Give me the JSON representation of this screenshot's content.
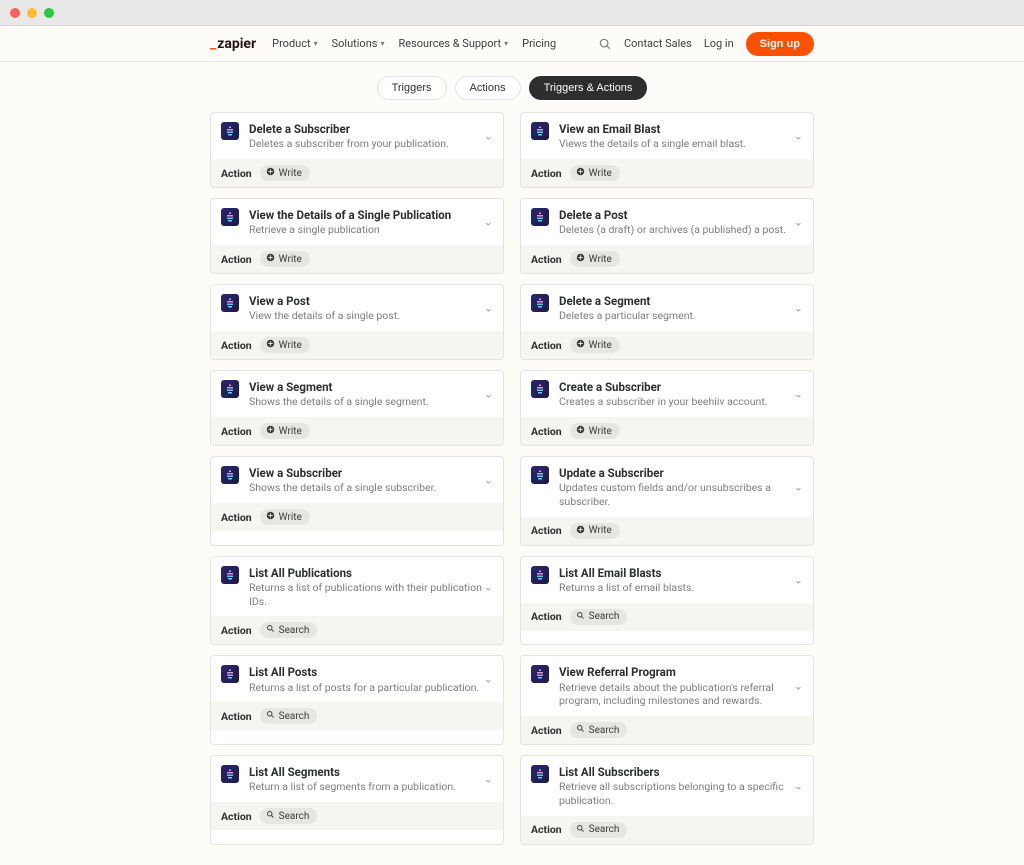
{
  "nav": {
    "brand": "zapier",
    "links": [
      {
        "label": "Product",
        "dropdown": true
      },
      {
        "label": "Solutions",
        "dropdown": true
      },
      {
        "label": "Resources & Support",
        "dropdown": true
      },
      {
        "label": "Pricing",
        "dropdown": false
      }
    ],
    "contact": "Contact Sales",
    "login": "Log in",
    "signup": "Sign up"
  },
  "filters": {
    "triggers": "Triggers",
    "actions": "Actions",
    "both": "Triggers & Actions"
  },
  "labels": {
    "kind_action": "Action",
    "chip_write": "Write",
    "chip_search": "Search"
  },
  "cards_left": [
    {
      "title": "Delete a Subscriber",
      "desc": "Deletes a subscriber from your publication.",
      "chip": "Write"
    },
    {
      "title": "View the Details of a Single Publication",
      "desc": "Retrieve a single publication",
      "chip": "Write"
    },
    {
      "title": "View a Post",
      "desc": "View the details of a single post.",
      "chip": "Write"
    },
    {
      "title": "View a Segment",
      "desc": "Shows the details of a single segment.",
      "chip": "Write"
    },
    {
      "title": "View a Subscriber",
      "desc": "Shows the details of a single subscriber.",
      "chip": "Write"
    },
    {
      "title": "List All Publications",
      "desc": "Returns a list of publications with their publication IDs.",
      "chip": "Search"
    },
    {
      "title": "List All Posts",
      "desc": "Returns a list of posts for a particular publication.",
      "chip": "Search"
    },
    {
      "title": "List All Segments",
      "desc": "Return a list of segments from a publication.",
      "chip": "Search"
    }
  ],
  "cards_right": [
    {
      "title": "View an Email Blast",
      "desc": "Views the details of a single email blast.",
      "chip": "Write"
    },
    {
      "title": "Delete a Post",
      "desc": "Deletes (a draft) or archives (a published) a post.",
      "chip": "Write"
    },
    {
      "title": "Delete a Segment",
      "desc": "Deletes a particular segment.",
      "chip": "Write"
    },
    {
      "title": "Create a Subscriber",
      "desc": "Creates a subscriber in your beehiiv account.",
      "chip": "Write"
    },
    {
      "title": "Update a Subscriber",
      "desc": "Updates custom fields and/or unsubscribes a subscriber.",
      "chip": "Write"
    },
    {
      "title": "List All Email Blasts",
      "desc": "Returns a list of email blasts.",
      "chip": "Search"
    },
    {
      "title": "View Referral Program",
      "desc": "Retrieve details about the publication's referral program, including milestones and rewards.",
      "chip": "Search"
    },
    {
      "title": "List All Subscribers",
      "desc": "Retrieve all subscriptions belonging to a specific publication.",
      "chip": "Search"
    }
  ]
}
